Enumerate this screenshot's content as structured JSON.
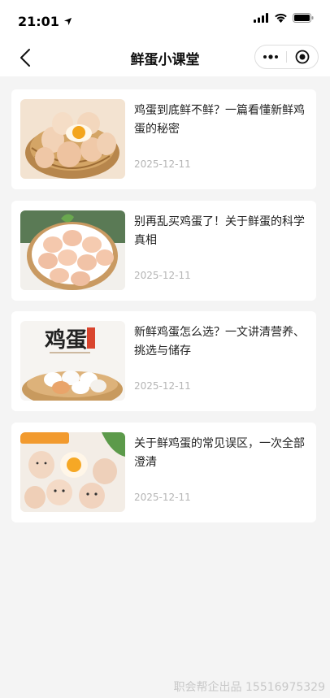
{
  "status_bar": {
    "time": "21:01"
  },
  "nav": {
    "title": "鲜蛋小课堂"
  },
  "articles": [
    {
      "title": "鸡蛋到底鲜不鲜？一篇看懂新鲜鸡蛋的秘密",
      "date": "2025-12-11"
    },
    {
      "title": "别再乱买鸡蛋了！关于鲜蛋的科学真相",
      "date": "2025-12-11"
    },
    {
      "title": "新鲜鸡蛋怎么选？一文讲清营养、挑选与储存",
      "date": "2025-12-11",
      "thumb_text": "鸡蛋"
    },
    {
      "title": "关于鲜鸡蛋的常见误区，一次全部澄清",
      "date": "2025-12-11"
    }
  ],
  "footer": {
    "text": "职会帮企出品 15516975329"
  }
}
